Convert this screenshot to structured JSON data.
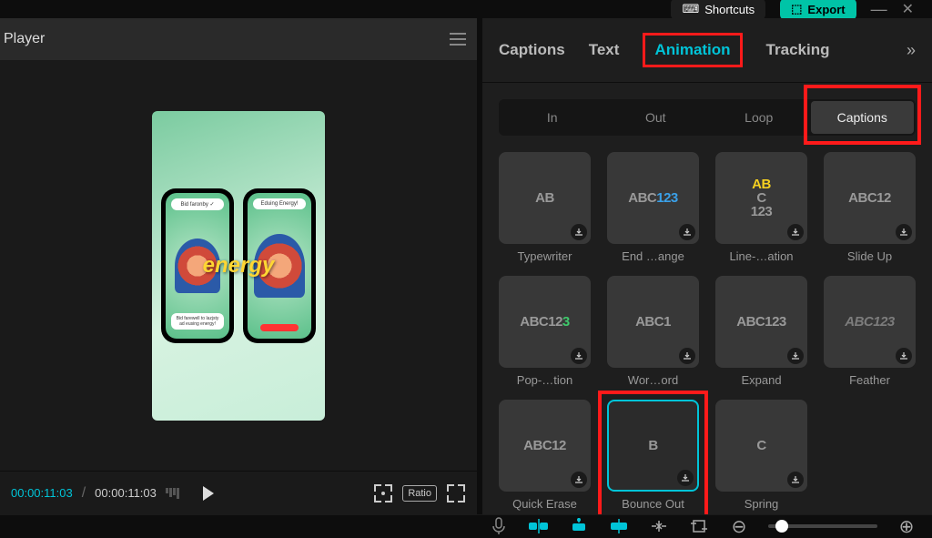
{
  "header": {
    "shortcuts_label": "Shortcuts",
    "export_label": "Export"
  },
  "player": {
    "title": "Player",
    "timecode_current": "00:00:11:03",
    "timecode_total": "00:00:11:03",
    "ratio_label": "Ratio",
    "caption_text": "energy",
    "phone1_bubble": "Bid faronby ✓",
    "phone1_bubble2": "Bid farewell to lazjsty ad eusing energy!",
    "phone2_bubble": "Eduing Energy!"
  },
  "tabs": {
    "captions": "Captions",
    "text": "Text",
    "animation": "Animation",
    "tracking": "Tracking"
  },
  "subtabs": {
    "in": "In",
    "out": "Out",
    "loop": "Loop",
    "captions": "Captions"
  },
  "animations": [
    {
      "thumb": "AB",
      "label": "Typewriter"
    },
    {
      "thumb": "ABC123",
      "label": "End …ange",
      "mixed": true
    },
    {
      "thumb": "AB\nC\n123",
      "label": "Line-…ation",
      "yellow": true
    },
    {
      "thumb": "ABC12",
      "label": "Slide Up"
    },
    {
      "thumb": "ABC123",
      "label": "Pop-…tion",
      "green": true
    },
    {
      "thumb": "ABC1",
      "label": "Wor…ord"
    },
    {
      "thumb": "ABC123",
      "label": "Expand"
    },
    {
      "thumb": "ABC123",
      "label": "Feather",
      "blur": true
    },
    {
      "thumb": "ABC12",
      "label": "Quick Erase"
    },
    {
      "thumb": "B",
      "label": "Bounce Out",
      "selected": true,
      "highlight": true
    },
    {
      "thumb": "C",
      "label": "Spring"
    }
  ]
}
